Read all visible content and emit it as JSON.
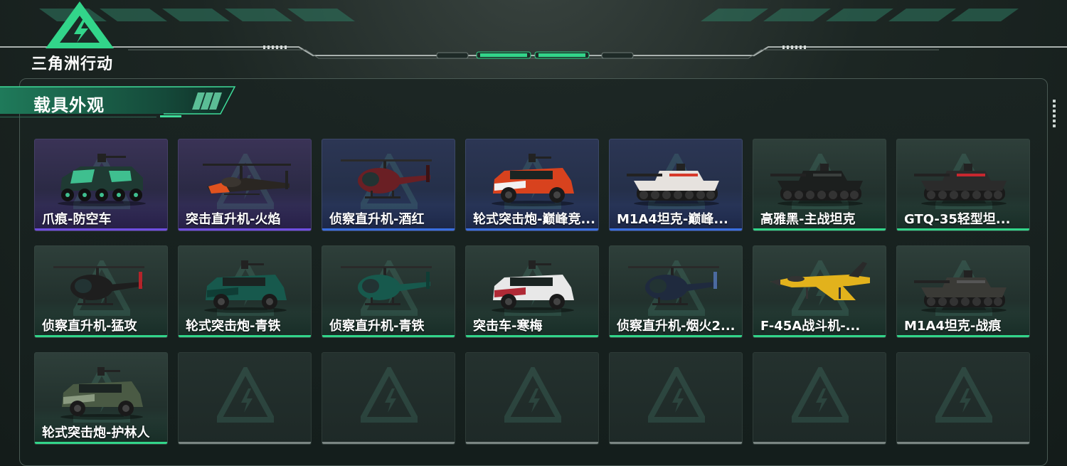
{
  "brand": {
    "logo_text": "三角洲行动",
    "accent": "#32d58a"
  },
  "section": {
    "title": "载具外观"
  },
  "colors": {
    "epic": "#6f4fe0",
    "rare": "#3a6fe0",
    "common": "#32d58a",
    "empty": "#7a8582"
  },
  "items": [
    {
      "label": "爪痕-防空车",
      "rarity": "purple",
      "vehicle": "ifv",
      "body": "#1f3a33",
      "accent": "#3fbf8f"
    },
    {
      "label": "突击直升机-火焰",
      "rarity": "purple",
      "vehicle": "attack-heli",
      "body": "#2a2622",
      "accent": "#e0521f"
    },
    {
      "label": "侦察直升机-酒红",
      "rarity": "blue",
      "vehicle": "scout-heli",
      "body": "#6a1f24",
      "accent": "#3a1214"
    },
    {
      "label": "轮式突击炮-巅峰竞...",
      "rarity": "blue",
      "vehicle": "armored-car",
      "body": "#d8421e",
      "accent": "#f2f2f2"
    },
    {
      "label": "M1A4坦克-巅峰...",
      "rarity": "blue",
      "vehicle": "tank",
      "body": "#e6e2de",
      "accent": "#d83a2a"
    },
    {
      "label": "高雅黑-主战坦克",
      "rarity": "green",
      "vehicle": "tank",
      "body": "#1c1f1e",
      "accent": "#3a3f3d"
    },
    {
      "label": "GTQ-35轻型坦...",
      "rarity": "green",
      "vehicle": "tank",
      "body": "#2b2b2b",
      "accent": "#c8272f"
    },
    {
      "label": "侦察直升机-猛攻",
      "rarity": "green",
      "vehicle": "scout-heli",
      "body": "#1e1e1e",
      "accent": "#b3242a"
    },
    {
      "label": "轮式突击炮-青铁",
      "rarity": "green",
      "vehicle": "armored-car",
      "body": "#17594d",
      "accent": "#0f3d35"
    },
    {
      "label": "侦察直升机-青铁",
      "rarity": "green",
      "vehicle": "scout-heli",
      "body": "#17594d",
      "accent": "#0f3d35"
    },
    {
      "label": "突击车-寒梅",
      "rarity": "green",
      "vehicle": "armored-car",
      "body": "#e8e8e8",
      "accent": "#b02a36"
    },
    {
      "label": "侦察直升机-烟火2...",
      "rarity": "green",
      "vehicle": "scout-heli",
      "body": "#1f2a3e",
      "accent": "#4b6aa0"
    },
    {
      "label": "F-45A战斗机-...",
      "rarity": "green",
      "vehicle": "jet",
      "body": "#e2b21c",
      "accent": "#2a2a2a"
    },
    {
      "label": "M1A4坦克-战痕",
      "rarity": "green",
      "vehicle": "tank",
      "body": "#3a3a36",
      "accent": "#555"
    },
    {
      "label": "轮式突击炮-护林人",
      "rarity": "green",
      "vehicle": "armored-car",
      "body": "#4a5a44",
      "accent": "#8a9a80"
    },
    {
      "label": "",
      "rarity": "empty",
      "vehicle": "none"
    },
    {
      "label": "",
      "rarity": "empty",
      "vehicle": "none"
    },
    {
      "label": "",
      "rarity": "empty",
      "vehicle": "none"
    },
    {
      "label": "",
      "rarity": "empty",
      "vehicle": "none"
    },
    {
      "label": "",
      "rarity": "empty",
      "vehicle": "none"
    },
    {
      "label": "",
      "rarity": "empty",
      "vehicle": "none"
    }
  ]
}
